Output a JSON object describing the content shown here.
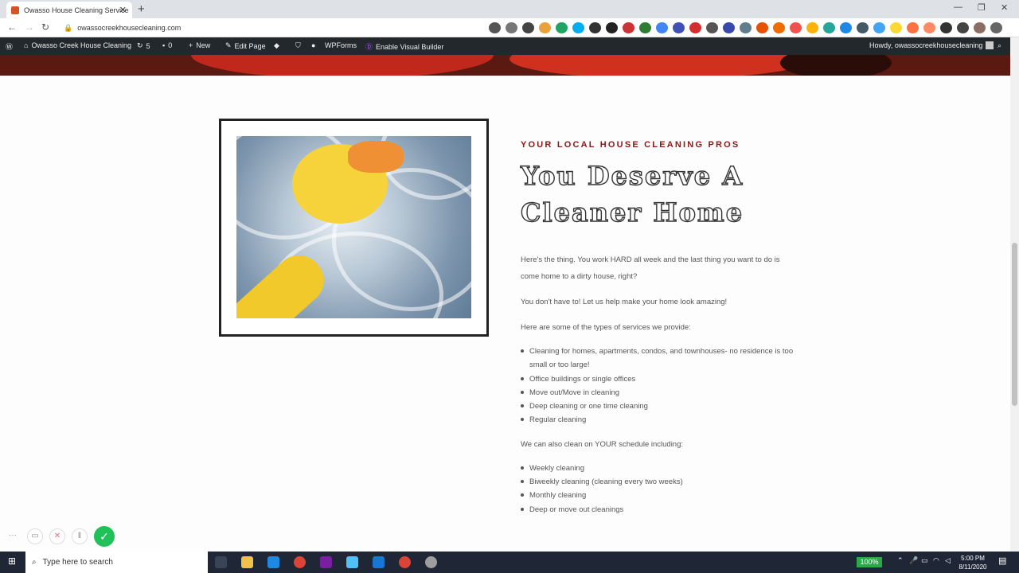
{
  "browser": {
    "tab_title": "Owasso House Cleaning Service",
    "tab_close": "✕",
    "new_tab": "+",
    "url": "owassocreekhousecleaning.com",
    "window_min": "—",
    "window_max": "❐",
    "window_close": "✕"
  },
  "wp_admin_bar": {
    "site_name": "Owasso Creek House Cleaning",
    "updates_count": "5",
    "comments_count": "0",
    "new_label": "New",
    "edit_page": "Edit Page",
    "wpforms": "WPForms",
    "visual_builder": "Enable Visual Builder",
    "howdy": "Howdy, owassocreekhousecleaning"
  },
  "main": {
    "eyebrow": "YOUR LOCAL HOUSE CLEANING PROS",
    "headline_line1": "You Deserve A",
    "headline_line2": "Cleaner Home",
    "intro": "Here's the thing. You work HARD all week and the last thing you want to do is come home to a dirty house, right?",
    "promise": "You don't have to! Let us help make your home look amazing!",
    "services_intro": "Here are some of the types of services we provide:",
    "services": [
      "Cleaning for homes, apartments, condos, and townhouses- no residence is too small or too large!",
      "Office buildings or single offices",
      "Move out/Move in cleaning",
      "Deep cleaning or one time cleaning",
      "Regular cleaning"
    ],
    "schedule_intro": "We can also clean on YOUR schedule including:",
    "schedule": [
      "Weekly cleaning",
      "Biweekly cleaning (cleaning every two weeks)",
      "Monthly cleaning",
      "Deep or move out cleanings"
    ]
  },
  "taskbar": {
    "search_placeholder": "Type here to search",
    "zoom": "100%",
    "time": "5:00 PM",
    "date": "8/11/2020"
  },
  "colors": {
    "accent": "#8a1616",
    "admin_bar": "#23282d",
    "record_ok": "#21c15a"
  }
}
